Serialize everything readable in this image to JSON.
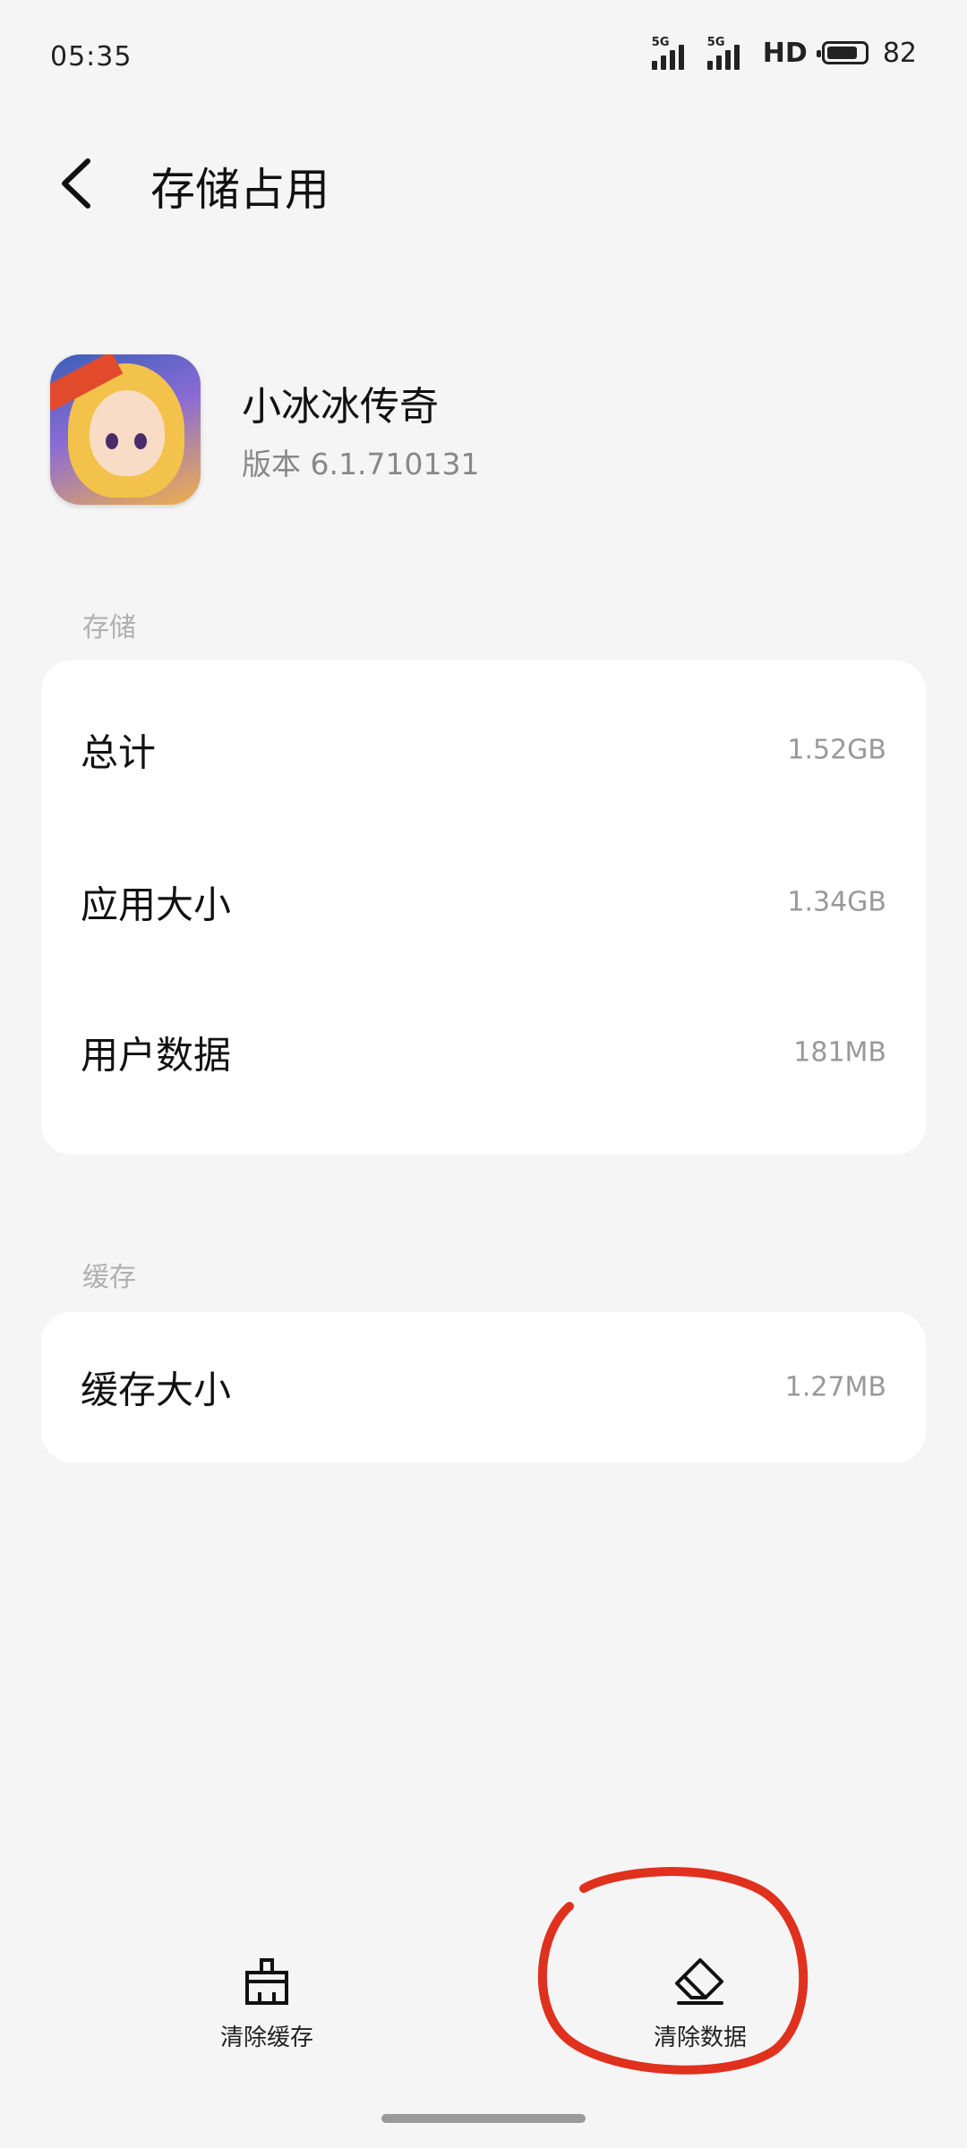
{
  "status_bar": {
    "time": "05:35",
    "signal1_tag": "5G",
    "signal2_tag": "5G",
    "hd": "HD",
    "battery": "82",
    "battery_level": 0.82
  },
  "header": {
    "back_icon": "chevron-left-icon",
    "title": "存储占用"
  },
  "app": {
    "icon": "app-icon",
    "name": "小冰冰传奇",
    "version": "版本 6.1.710131"
  },
  "storage": {
    "section_label": "存储",
    "rows": [
      {
        "label": "总计",
        "value": "1.52GB"
      },
      {
        "label": "应用大小",
        "value": "1.34GB"
      },
      {
        "label": "用户数据",
        "value": "181MB"
      }
    ]
  },
  "cache": {
    "section_label": "缓存",
    "rows": [
      {
        "label": "缓存大小",
        "value": "1.27MB"
      }
    ]
  },
  "actions": {
    "clear_cache": {
      "label": "清除缓存",
      "icon": "broom-icon"
    },
    "clear_data": {
      "label": "清除数据",
      "icon": "eraser-icon"
    }
  },
  "annotation": {
    "color": "#e0301e"
  }
}
